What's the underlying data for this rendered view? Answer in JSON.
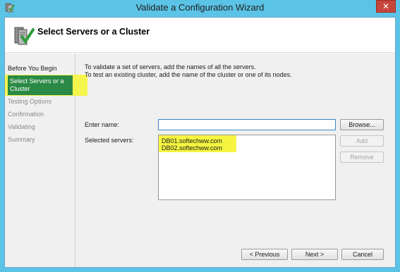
{
  "window": {
    "title": "Validate a Configuration Wizard",
    "close_label": "✕"
  },
  "header": {
    "title": "Select Servers or a Cluster"
  },
  "nav": {
    "items": [
      {
        "label": "Before You Begin",
        "state": "done"
      },
      {
        "label": "Select Servers or a Cluster",
        "state": "current"
      },
      {
        "label": "Testing Options",
        "state": "pending"
      },
      {
        "label": "Confirmation",
        "state": "pending"
      },
      {
        "label": "Validating",
        "state": "pending"
      },
      {
        "label": "Summary",
        "state": "pending"
      }
    ]
  },
  "main": {
    "intro_line1": "To validate a set of servers, add the names of all the servers.",
    "intro_line2": "To test an existing cluster, add the name of the cluster or one of its nodes.",
    "enter_name_label": "Enter name:",
    "enter_name_value": "",
    "selected_servers_label": "Selected servers:",
    "selected_servers": [
      "DB01.softechww.com",
      "DB02.softechww.com"
    ],
    "browse_label": "Browse...",
    "add_label": "Add",
    "remove_label": "Remove"
  },
  "footer": {
    "previous_label": "< Previous",
    "next_label": "Next >",
    "cancel_label": "Cancel"
  },
  "colors": {
    "title_bar": "#5bc4e6",
    "nav_current": "#2a8a45",
    "highlight": "#f4f53b",
    "close_button": "#c7463c"
  }
}
